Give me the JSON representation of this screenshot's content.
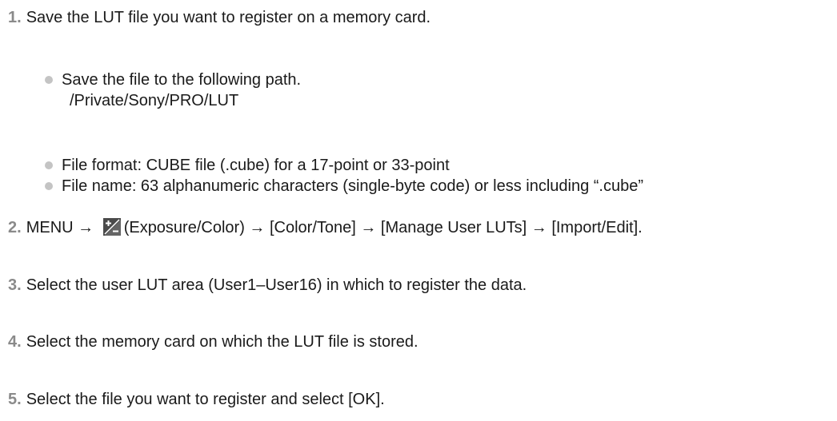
{
  "steps": [
    {
      "num": "1.",
      "text": "Save the LUT file you want to register on a memory card."
    },
    {
      "num": "2.",
      "text_before": "MENU → ",
      "icon": "exposure-color-icon",
      "text_after": "(Exposure/Color) → [Color/Tone] → [Manage User LUTs] → [Import/Edit]."
    },
    {
      "num": "3.",
      "text": "Select the user LUT area (User1–User16) in which to register the data."
    },
    {
      "num": "4.",
      "text": "Select the memory card on which the LUT file is stored."
    },
    {
      "num": "5.",
      "text": "Select the file you want to register and select [OK]."
    }
  ],
  "step1_notes": [
    {
      "text": "Save the file to the following path.",
      "sub": "/Private/Sony/PRO/LUT"
    },
    {
      "text": "File format: CUBE file (.cube) for a 17-point or 33-point"
    },
    {
      "text": "File name: 63 alphanumeric characters (single-byte code) or less including “.cube”"
    }
  ],
  "colors": {
    "step_number": "#8a8a8a",
    "bullet": "#c4c4c4",
    "icon_bg": "#4a4a4a"
  }
}
